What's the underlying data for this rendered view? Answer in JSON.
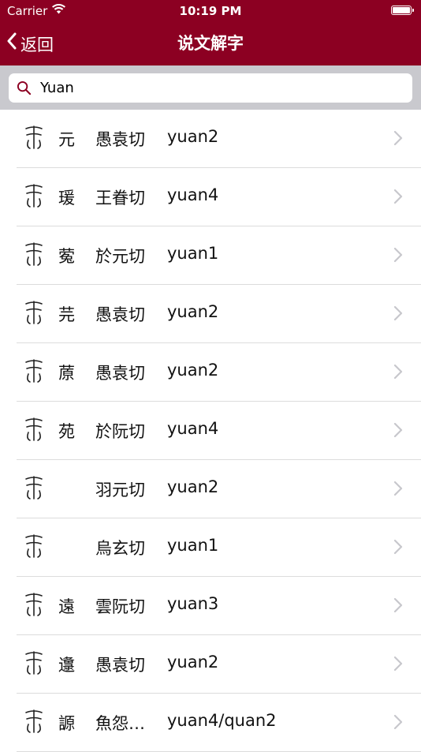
{
  "status_bar": {
    "carrier": "Carrier",
    "time": "10:19 PM",
    "battery_level": 1.0
  },
  "nav": {
    "back_label": "返回",
    "title": "说文解字"
  },
  "search": {
    "value": "Yuan",
    "placeholder": ""
  },
  "colors": {
    "brand": "#8c0022",
    "search_bar_bg": "#c9c9ce",
    "separator": "#dcdcdc",
    "chevron": "#c7c7cc"
  },
  "results": [
    {
      "char": "元",
      "fanqie": "愚袁切",
      "pinyin": "yuan2"
    },
    {
      "char": "瑗",
      "fanqie": "王眷切",
      "pinyin": "yuan4"
    },
    {
      "char": "蒬",
      "fanqie": "於元切",
      "pinyin": "yuan1"
    },
    {
      "char": "芫",
      "fanqie": "愚袁切",
      "pinyin": "yuan2"
    },
    {
      "char": "蒝",
      "fanqie": "愚袁切",
      "pinyin": "yuan2"
    },
    {
      "char": "苑",
      "fanqie": "於阮切",
      "pinyin": "yuan4"
    },
    {
      "char": "",
      "fanqie": "羽元切",
      "pinyin": "yuan2"
    },
    {
      "char": "",
      "fanqie": "烏玄切",
      "pinyin": "yuan1"
    },
    {
      "char": "遠",
      "fanqie": "雲阮切",
      "pinyin": "yuan3"
    },
    {
      "char": "邍",
      "fanqie": "愚袁切",
      "pinyin": "yuan2"
    },
    {
      "char": "謜",
      "fanqie": "魚怨…",
      "pinyin": "yuan4/quan2"
    }
  ]
}
